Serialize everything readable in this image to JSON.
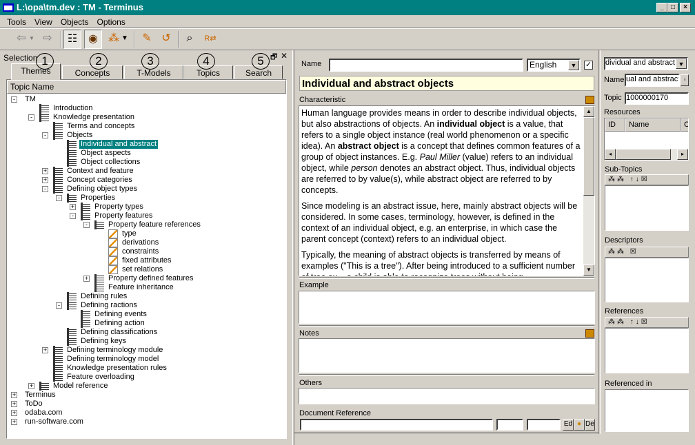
{
  "window": {
    "title": "L:\\opa\\tm.dev : TM - Terminus",
    "controls": [
      "_",
      "□",
      "×"
    ]
  },
  "menu": [
    "Tools",
    "View",
    "Objects",
    "Options"
  ],
  "toolbar": {
    "back": "⇦",
    "forward": "⇨",
    "tree": "☷",
    "concept": "◉",
    "objects": "⁂",
    "dropdown": "▼",
    "edit": "✎",
    "undo": "↺",
    "search": "⌕",
    "replace": "R⇄"
  },
  "selection": {
    "title": "Selection",
    "restore": "🗗",
    "close": "✕",
    "tabs": [
      {
        "label": "Themes",
        "num": "1"
      },
      {
        "label": "Concepts",
        "num": "2"
      },
      {
        "label": "T-Models",
        "num": "3"
      },
      {
        "label": "Topics",
        "num": "4"
      },
      {
        "label": "Search",
        "num": "5"
      }
    ],
    "column": "Topic Name",
    "tree": [
      {
        "label": "TM",
        "level": 0,
        "exp": "-",
        "icon": "none"
      },
      {
        "label": "Introduction",
        "level": 1,
        "exp": "",
        "icon": "book"
      },
      {
        "label": "Knowledge presentation",
        "level": 1,
        "exp": "-",
        "icon": "book"
      },
      {
        "label": "Terms and concepts",
        "level": 2,
        "exp": "",
        "icon": "book"
      },
      {
        "label": "Objects",
        "level": 2,
        "exp": "-",
        "icon": "book"
      },
      {
        "label": "Individual and abstract",
        "level": 3,
        "exp": "",
        "icon": "book",
        "selected": true
      },
      {
        "label": "Object aspects",
        "level": 3,
        "exp": "",
        "icon": "book"
      },
      {
        "label": "Object collections",
        "level": 3,
        "exp": "",
        "icon": "book"
      },
      {
        "label": "Context and feature",
        "level": 2,
        "exp": "+",
        "icon": "book"
      },
      {
        "label": "Concept categories",
        "level": 2,
        "exp": "+",
        "icon": "book"
      },
      {
        "label": "Defining object types",
        "level": 2,
        "exp": "-",
        "icon": "book"
      },
      {
        "label": "Properties",
        "level": 3,
        "exp": "-",
        "icon": "book"
      },
      {
        "label": "Property types",
        "level": 4,
        "exp": "+",
        "icon": "book"
      },
      {
        "label": "Property features",
        "level": 4,
        "exp": "-",
        "icon": "book"
      },
      {
        "label": "Property feature references",
        "level": 5,
        "exp": "-",
        "icon": "book"
      },
      {
        "label": "type",
        "level": 6,
        "exp": "",
        "icon": "pen"
      },
      {
        "label": "derivations",
        "level": 6,
        "exp": "",
        "icon": "pen"
      },
      {
        "label": "constraints",
        "level": 6,
        "exp": "",
        "icon": "pen"
      },
      {
        "label": "fixed attributes",
        "level": 6,
        "exp": "",
        "icon": "pen"
      },
      {
        "label": "set relations",
        "level": 6,
        "exp": "",
        "icon": "pen"
      },
      {
        "label": "Property defined features",
        "level": 5,
        "exp": "+",
        "icon": "book"
      },
      {
        "label": "Feature inheritance",
        "level": 5,
        "exp": "",
        "icon": "book"
      },
      {
        "label": "Defining rules",
        "level": 3,
        "exp": "",
        "icon": "book"
      },
      {
        "label": "Defining ractions",
        "level": 3,
        "exp": "-",
        "icon": "book"
      },
      {
        "label": "Defining events",
        "level": 4,
        "exp": "",
        "icon": "book"
      },
      {
        "label": "Defining action",
        "level": 4,
        "exp": "",
        "icon": "book"
      },
      {
        "label": "Defining classifications",
        "level": 3,
        "exp": "",
        "icon": "book"
      },
      {
        "label": "Defining keys",
        "level": 3,
        "exp": "",
        "icon": "book"
      },
      {
        "label": "Defining terminology module",
        "level": 2,
        "exp": "+",
        "icon": "book"
      },
      {
        "label": "Defining terminology model",
        "level": 2,
        "exp": "",
        "icon": "book"
      },
      {
        "label": "Knowledge presentation rules",
        "level": 2,
        "exp": "",
        "icon": "book"
      },
      {
        "label": "Feature overloading",
        "level": 2,
        "exp": "",
        "icon": "book"
      },
      {
        "label": "Model reference",
        "level": 1,
        "exp": "+",
        "icon": "book"
      },
      {
        "label": "Terminus",
        "level": 0,
        "exp": "+",
        "icon": "none"
      },
      {
        "label": "ToDo",
        "level": 0,
        "exp": "+",
        "icon": "none"
      },
      {
        "label": "odaba.com",
        "level": 0,
        "exp": "+",
        "icon": "none"
      },
      {
        "label": "run-software.com",
        "level": 0,
        "exp": "+",
        "icon": "none"
      }
    ]
  },
  "detail": {
    "name_label": "Name",
    "name_value": "",
    "language": "English",
    "checkbox_checked": true,
    "title": "Individual and abstract objects",
    "characteristic_label": "Characteristic",
    "paragraphs": [
      [
        "Human language provides means in order to describe individual objects, but also abstractions of objects. An ",
        "individual object",
        " is a value, that refers to a single object instance (real world phenomenon or a specific idea). An ",
        "abstract object",
        " is a concept that defines common features of a group of object instances. E.g. ",
        "Paul Miller",
        " (value) refers to an individual object, while ",
        "person",
        " denotes an abstract object. Thus, individual objects are referred to by value(s), while abstract object are referred to by concepts."
      ],
      "Since modeling is an abstract issue, here, mainly abstract objects will be considered. In some cases, terminology, however, is defined in the context of an individual object, e.g. an enterprise, in which case the parent concept (context) refers to an individual object.",
      "Typically, the meaning of abstract objects is transferred by means of examples (\"This is a tree\"). After being introduced to a sufficient number of tree ex... a child is able to recognize trees without being..."
    ],
    "example_label": "Example",
    "notes_label": "Notes",
    "others_label": "Others",
    "docref_label": "Document Reference",
    "docref_buttons": [
      "Ed",
      "●",
      "Del"
    ]
  },
  "right": {
    "combo": "dividual and abstract",
    "name_label": "Name",
    "name_value": "ual and abstract",
    "topic_label": "Topic",
    "topic_value": "1000000170",
    "resources_label": "Resources",
    "resources_cols": [
      "ID",
      "Name",
      "C"
    ],
    "subtopics_label": "Sub-Topics",
    "descriptors_label": "Descriptors",
    "references_label": "References",
    "referenced_in_label": "Referenced in",
    "mini_toolbar_full": "⁂⁂ ↑↓☒",
    "mini_toolbar_short": "⁂⁂ ☒"
  }
}
